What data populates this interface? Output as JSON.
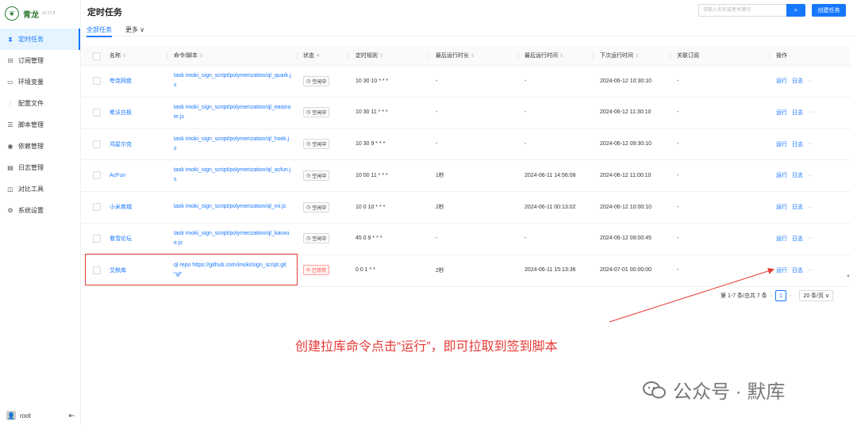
{
  "app": {
    "name": "青龙",
    "version": "v2.17.5"
  },
  "sidebar": {
    "items": [
      {
        "label": "定时任务",
        "icon": "clock-icon",
        "active": true
      },
      {
        "label": "订阅管理",
        "icon": "subscription-icon"
      },
      {
        "label": "环境变量",
        "icon": "env-icon"
      },
      {
        "label": "配置文件",
        "icon": "config-icon"
      },
      {
        "label": "脚本管理",
        "icon": "script-icon"
      },
      {
        "label": "依赖管理",
        "icon": "dependency-icon"
      },
      {
        "label": "日志管理",
        "icon": "log-icon"
      },
      {
        "label": "对比工具",
        "icon": "diff-icon"
      },
      {
        "label": "系统设置",
        "icon": "settings-icon"
      }
    ],
    "user": "root"
  },
  "header": {
    "title": "定时任务",
    "search_placeholder": "请输入名称或者关键词",
    "create_label": "创建任务"
  },
  "tabs": {
    "all": "全部任务",
    "more": "更多"
  },
  "table": {
    "columns": [
      "名称",
      "命令/脚本",
      "状态",
      "定时规则",
      "最后运行时长",
      "最后运行时间",
      "下次运行时间",
      "关联订阅",
      "操作"
    ],
    "rows": [
      {
        "name": "夸克网盘",
        "command": "task imoki_sign_script/polymerization/ql_quark.js",
        "status": "空闲中",
        "schedule": "10 30 10 * * *",
        "duration": "-",
        "last_run": "-",
        "next_run": "2024-06-12 10:30:10",
        "sub": "-"
      },
      {
        "name": "希沃白板",
        "command": "task imoki_sign_script/polymerization/ql_easinote.js",
        "status": "空闲中",
        "schedule": "10 30 11 * * *",
        "duration": "-",
        "last_run": "-",
        "next_run": "2024-06-12 11:30:10",
        "sub": "-"
      },
      {
        "name": "鸿星尔克",
        "command": "task imoki_sign_script/polymerization/ql_hxek.js",
        "status": "空闲中",
        "schedule": "10 30 9 * * *",
        "duration": "-",
        "last_run": "-",
        "next_run": "2024-06-12 09:30:10",
        "sub": "-"
      },
      {
        "name": "AcFun",
        "command": "task imoki_sign_script/polymerization/ql_acfun.js",
        "status": "空闲中",
        "schedule": "10 00 11 * * *",
        "duration": "1秒",
        "last_run": "2024-06-11 14:56:08",
        "next_run": "2024-06-12 11:00:10",
        "sub": "-"
      },
      {
        "name": "小米商城",
        "command": "task imoki_sign_script/polymerization/ql_mi.js",
        "status": "空闲中",
        "schedule": "10 0 10 * * *",
        "duration": "2秒",
        "last_run": "2024-06-11 00:13:02",
        "next_run": "2024-06-12 10:00:10",
        "sub": "-"
      },
      {
        "name": "看雪论坛",
        "command": "task imoki_sign_script/polymerization/ql_kanxue.js",
        "status": "空闲中",
        "schedule": "45 0 9 * * *",
        "duration": "-",
        "last_run": "-",
        "next_run": "2024-06-12 09:00:45",
        "sub": "-"
      },
      {
        "name": "艾默库",
        "command": "ql repo https://github.com/imoki/sign_script.git \"ql\"",
        "status": "已禁用",
        "disabled": true,
        "schedule": "0 0 1 * *",
        "duration": "2秒",
        "last_run": "2024-06-11 15:13:36",
        "next_run": "2024-07-01 00:00:00",
        "sub": "-"
      }
    ],
    "ops": {
      "run": "运行",
      "log": "日志",
      "more": "···"
    }
  },
  "pagination": {
    "summary": "第 1-7 条/总共 7 条",
    "page": "1",
    "size": "20 条/页"
  },
  "annotation": "创建拉库命令点击“运行”，即可拉取到签到脚本",
  "watermark": "公众号 · 默库",
  "colors": {
    "primary": "#1677ff",
    "brand": "#2e7d32",
    "annotation": "#e53935"
  }
}
